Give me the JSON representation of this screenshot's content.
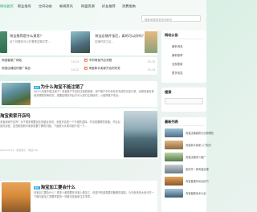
{
  "nav": {
    "items": [
      "网站首页",
      "职业指导",
      "空间动态",
      "新闻资讯",
      "网盘资源",
      "好友推荐",
      "消费指南"
    ],
    "search_placeholder": "搜索关键词关闭当前页"
  },
  "featured": [
    {
      "title": "淘宝推荐是什么意思？",
      "sub": "这个问题你可以先看看这篇文章..."
    },
    {
      "title": "淘宝店铺开张后，真的可以好吗？",
      "sub": "店铺开张之后..."
    }
  ],
  "quick_links": [
    {
      "title": "淘宝客推广网站",
      "date": "10-13",
      "hot": false
    },
    {
      "title": "不同淘宝开店流程",
      "date": "10-13",
      "hot": true
    },
    {
      "title": "淘宝店铺如何推广商品",
      "date": "10-12",
      "hot": false
    },
    {
      "title": "淘宝新手卖家开店的好处",
      "date": "10-14",
      "hot": true
    }
  ],
  "posts": [
    {
      "badge": "推荐",
      "title": "为什么淘宝不能注销了",
      "text": "为什么淘宝不能注销了？淘宝账户不支持注销的原因：用户账户中仍存在未完成的交易订单、余额或者有其他关联服务等情况，需要处理完毕后才可以进行注销操作，以保障账户安全...",
      "meta": "2022-07-09 · 网站运营 · 阅读(88)"
    },
    {
      "badge": "",
      "title": "淘宝卖家开店吗",
      "text": "淘宝卖家开店吗？对于很多想要创业的朋友来说，淘宝开店是一个不错的选择。开店需要哪些准备，开店后如何运营，这些都是新手卖家需要了解的问题，下面就为大家详细介绍一下...",
      "meta": "2022-05-19 · 淘宝知识 · 阅读(76)"
    },
    {
      "badge": "推荐",
      "title": "淘宝加工要会什么",
      "text": "淘宝加工要会什么？很多人都想要在淘宝上做加工，但是不知道需要具备哪些技能，今天就来给大家分享一下做淘宝加工需要掌握的一些基本技能和注意事项...",
      "meta": ""
    }
  ],
  "sidebar": {
    "section1": "网站公告",
    "links": [
      "最新消息",
      "最新推荐",
      "全部更新",
      "更多信息"
    ],
    "search_title": "搜索",
    "latest_title": "最新列表",
    "latest": [
      "淘宝店铺装修方法有哪些",
      "淘宝新手卖家入门知识",
      "淘宝店铺怎么推广",
      "如何开一家淘宝店铺",
      "淘宝直通车优化技巧",
      "淘宝客服话术大全"
    ]
  }
}
